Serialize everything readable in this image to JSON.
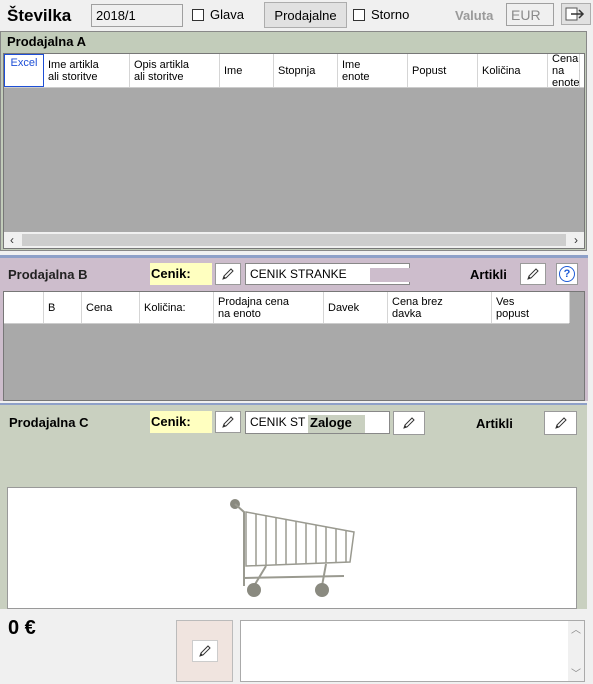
{
  "header": {
    "stevilka_label": "Številka",
    "stevilka_value": "2018/1",
    "glava_label": "Glava",
    "prodajalne_button": "Prodajalne",
    "storno_label": "Storno",
    "valuta_label": "Valuta",
    "valuta_value": "EUR"
  },
  "section_a": {
    "title": "Prodajalna A",
    "columns": [
      "Excel",
      "Ime artikla\nali storitve",
      "Opis artikla\nali storitve",
      "Ime",
      "Stopnja",
      "Ime\nenote",
      "Popust",
      "Količina",
      "Cena na\nenote"
    ]
  },
  "section_b": {
    "title": "Prodajalna B",
    "cenik_label": "Cenik:",
    "cenik_value": "CENIK STRANKE",
    "artikli_label": "Artikli",
    "help_icon": "?",
    "columns": [
      "",
      "B",
      "Cena",
      "Količina:",
      "Prodajna cena\nna enoto",
      "Davek",
      "Cena brez\ndavka",
      "Ves\npopust"
    ]
  },
  "section_c": {
    "title": "Prodajalna C",
    "cenik_label": "Cenik:",
    "cenik_value": "CENIK ST",
    "zaloge_label": "Zaloge",
    "artikli_label": "Artikli"
  },
  "footer": {
    "total": "0 €"
  },
  "colors": {
    "section_a_bg": "#c2ccba",
    "section_b_bg": "#cdbdcc",
    "section_c_bg": "#c9d0c0",
    "grid_empty": "#a9a9a9",
    "cenik_bg": "#ffffc0"
  }
}
